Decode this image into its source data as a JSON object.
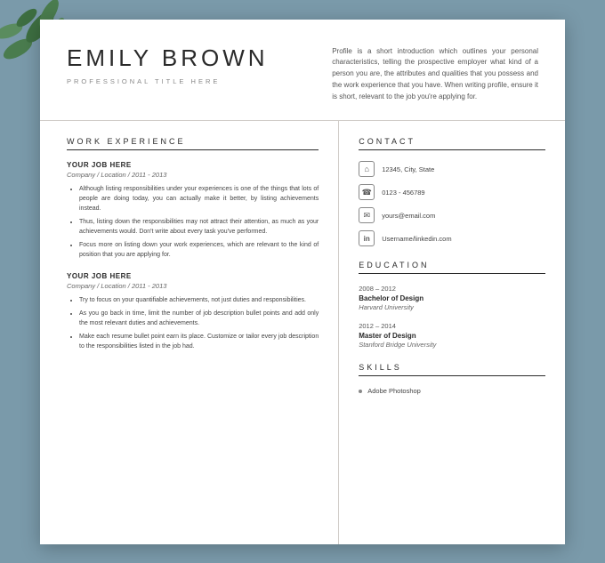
{
  "page": {
    "background_color": "#7a9aaa"
  },
  "header": {
    "name": "EMILY BROWN",
    "title": "PROFESSIONAL TITLE HERE",
    "profile_text": "Profile is a short introduction which outlines your personal characteristics, telling the prospective employer what kind of a person you are, the attributes and qualities that you possess and the work experience that you have. When writing profile, ensure it is short, relevant to the job you're applying for."
  },
  "sections": {
    "work_experience": {
      "label": "WORK EXPERIENCE",
      "jobs": [
        {
          "title": "YOUR JOB HERE",
          "subtitle": "Company / Location / 2011 - 2013",
          "bullets": [
            "Although listing responsibilities under your experiences is one of the things that lots of people are doing today, you can actually make it better, by listing achievements instead.",
            "Thus, listing down the responsibilities may not attract their attention, as much as your achievements would. Don't write about every task you've performed.",
            "Focus more on listing down your work experiences, which are relevant to the kind of position that you are applying for."
          ]
        },
        {
          "title": "YOUR JOB HERE",
          "subtitle": "Company / Location / 2011 - 2013",
          "bullets": [
            "Try to focus on your quantifiable achievements, not just duties and responsibilities.",
            "As you go back in time, limit the number of job description bullet points and add only the most relevant duties and achievements.",
            "Make each resume bullet point earn its place. Customize or tailor every job description to the responsibilities listed in the job had."
          ]
        }
      ]
    },
    "contact": {
      "label": "CONTACT",
      "items": [
        {
          "icon": "🏠",
          "icon_name": "home-icon",
          "text": "12345, City, State"
        },
        {
          "icon": "📞",
          "icon_name": "phone-icon",
          "text": "0123 - 456789"
        },
        {
          "icon": "✉",
          "icon_name": "email-icon",
          "text": "yours@email.com"
        },
        {
          "icon": "in",
          "icon_name": "linkedin-icon",
          "text": "Username/linkedin.com"
        }
      ]
    },
    "education": {
      "label": "EDUCATION",
      "items": [
        {
          "years": "2008 – 2012",
          "degree": "Bachelor of Design",
          "school": "Harvard University"
        },
        {
          "years": "2012 – 2014",
          "degree": "Master of Design",
          "school": "Stanford Bridge University"
        }
      ]
    },
    "skills": {
      "label": "SKILLS",
      "items": [
        "Adobe Photoshop"
      ]
    }
  }
}
